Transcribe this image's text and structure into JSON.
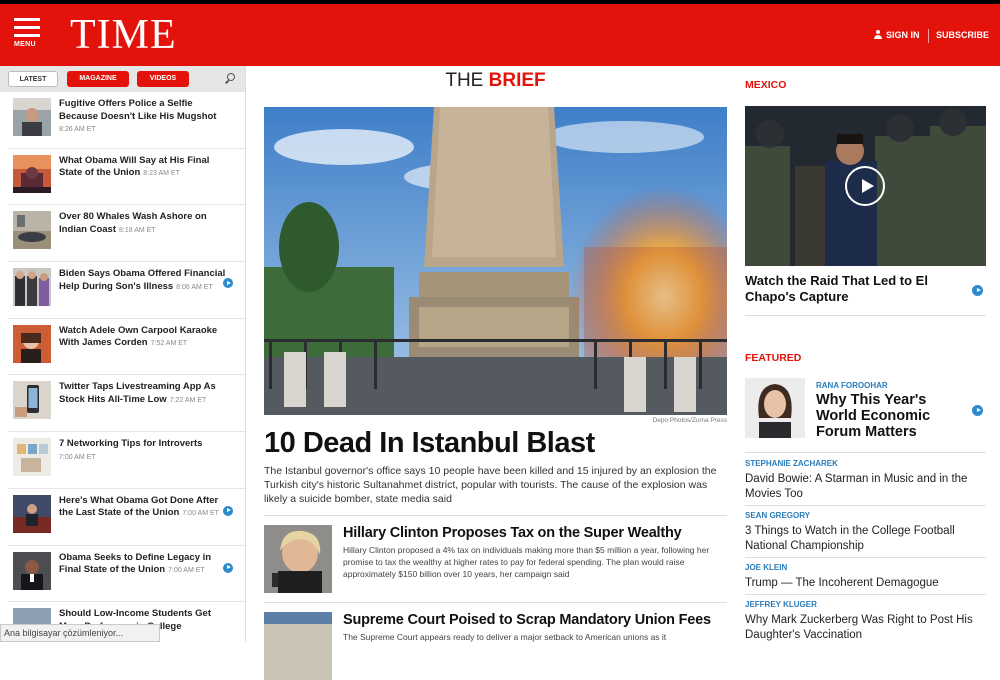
{
  "header": {
    "menu_label": "MENU",
    "logo": "TIME",
    "sign_in": "SIGN IN",
    "subscribe": "SUBSCRIBE",
    "brand_color": "#e3120b"
  },
  "sidebar": {
    "tabs": [
      {
        "label": "LATEST",
        "active": true
      },
      {
        "label": "MAGAZINE",
        "active": false
      },
      {
        "label": "VIDEOS",
        "active": false
      }
    ],
    "search_icon": "search-icon",
    "items": [
      {
        "title": "Fugitive Offers Police a Selfie Because Doesn't Like His Mugshot",
        "time": "8:26 AM ET",
        "video": false
      },
      {
        "title": "What Obama Will Say at His Final State of the Union",
        "time": "8:23 AM ET",
        "video": false
      },
      {
        "title": "Over 80 Whales Wash Ashore on Indian Coast",
        "time": "8:18 AM ET",
        "video": false
      },
      {
        "title": "Biden Says Obama Offered Financial Help During Son's Illness",
        "time": "8:06 AM ET",
        "video": true
      },
      {
        "title": "Watch Adele Own Carpool Karaoke With James Corden",
        "time": "7:52 AM ET",
        "video": false
      },
      {
        "title": "Twitter Taps Livestreaming App As Stock Hits All-Time Low",
        "time": "7:22 AM ET",
        "video": false
      },
      {
        "title": "7 Networking Tips for Introverts",
        "time": "7:00 AM ET",
        "video": false
      },
      {
        "title": "Here's What Obama Got Done After the Last State of the Union",
        "time": "7:00 AM ET",
        "video": true
      },
      {
        "title": "Obama Seeks to Define Legacy in Final State of the Union",
        "time": "7:00 AM ET",
        "video": true
      },
      {
        "title": "Should Low-Income Students Get More Preference in College",
        "time": "",
        "video": false
      }
    ]
  },
  "status_bar": "Ana bilgisayar çözümleniyor...",
  "main": {
    "section_prefix": "THE",
    "section_highlight": "BRIEF",
    "photo_credit": "Depo Photos/Zuma Press",
    "headline": "10 Dead In Istanbul Blast",
    "summary": "The Istanbul governor's office says 10 people have been killed and 15 injured by an explosion the Turkish city's historic Sultanahmet district, popular with tourists. The cause of the explosion was likely a suicide bomber, state media said",
    "stories": [
      {
        "title": "Hillary Clinton Proposes Tax on the Super Wealthy",
        "desc": "Hillary Clinton proposed a 4% tax on individuals making more than $5 million a year, following her promise to tax the wealthy at higher rates to pay for federal spending. The plan would raise approximately $150 billion over 10 years, her campaign said"
      },
      {
        "title": "Supreme Court Poised to Scrap Mandatory Union Fees",
        "desc": "The Supreme Court appears ready to deliver a major setback to American unions as it"
      }
    ]
  },
  "right": {
    "mexico_label": "MEXICO",
    "video_title": "Watch the Raid That Led to El Chapo's Capture",
    "featured_label": "FEATURED",
    "featured": {
      "author": "RANA FOROOHAR",
      "title": "Why This Year's World Economic Forum Matters"
    },
    "articles": [
      {
        "author": "STEPHANIE ZACHAREK",
        "title": "David Bowie: A Starman in Music and in the Movies Too"
      },
      {
        "author": "SEAN GREGORY",
        "title": "3 Things to Watch in the College Football National Championship"
      },
      {
        "author": "JOE KLEIN",
        "title": "Trump — The Incoherent Demagogue"
      },
      {
        "author": "JEFFREY KLUGER",
        "title": "Why Mark Zuckerberg Was Right to Post His Daughter's Vaccination"
      }
    ]
  }
}
